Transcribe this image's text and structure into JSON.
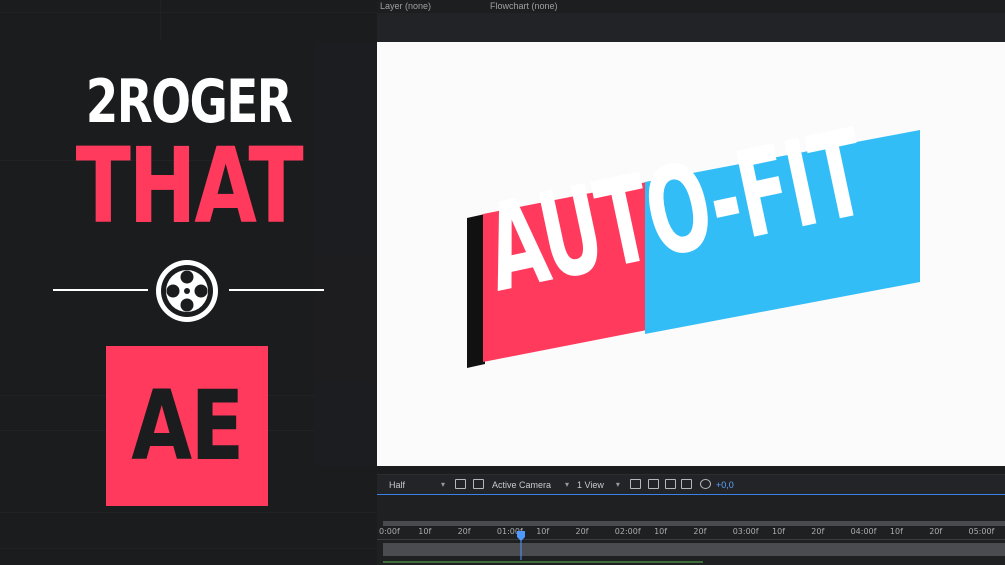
{
  "branding": {
    "line1": "2ROGER",
    "line2": "THAT",
    "badge": "AE",
    "reel_icon": "film-reel-icon",
    "colors": {
      "accent": "#ff3a5d",
      "text": "#ffffff",
      "background": "#1b1c1e"
    }
  },
  "top_bar": {
    "layer_label": "Layer (none)",
    "flowchart_label": "Flowchart (none)"
  },
  "viewer": {
    "logo_text": "AUTO-FIT",
    "colors": {
      "red_panel": "#ff3a5d",
      "blue_panel": "#33bdf7",
      "stripe": "#111111",
      "background": "#fbfbfb"
    }
  },
  "toolbar": {
    "resolution": "Half",
    "camera": "Active Camera",
    "views": "1 View",
    "exposure": "+0,0",
    "icons": [
      "region-of-interest-icon",
      "transparency-grid-icon",
      "fast-preview-icon",
      "timeline-icon",
      "channel-icon",
      "flowchart-icon",
      "reset-exposure-icon"
    ]
  },
  "timeline": {
    "ticks": [
      "0:00f",
      "10f",
      "20f",
      "01:00f",
      "10f",
      "20f",
      "02:00f",
      "10f",
      "20f",
      "03:00f",
      "10f",
      "20f",
      "04:00f",
      "10f",
      "20f",
      "05:00f"
    ],
    "playhead_icon": "playhead-icon"
  }
}
